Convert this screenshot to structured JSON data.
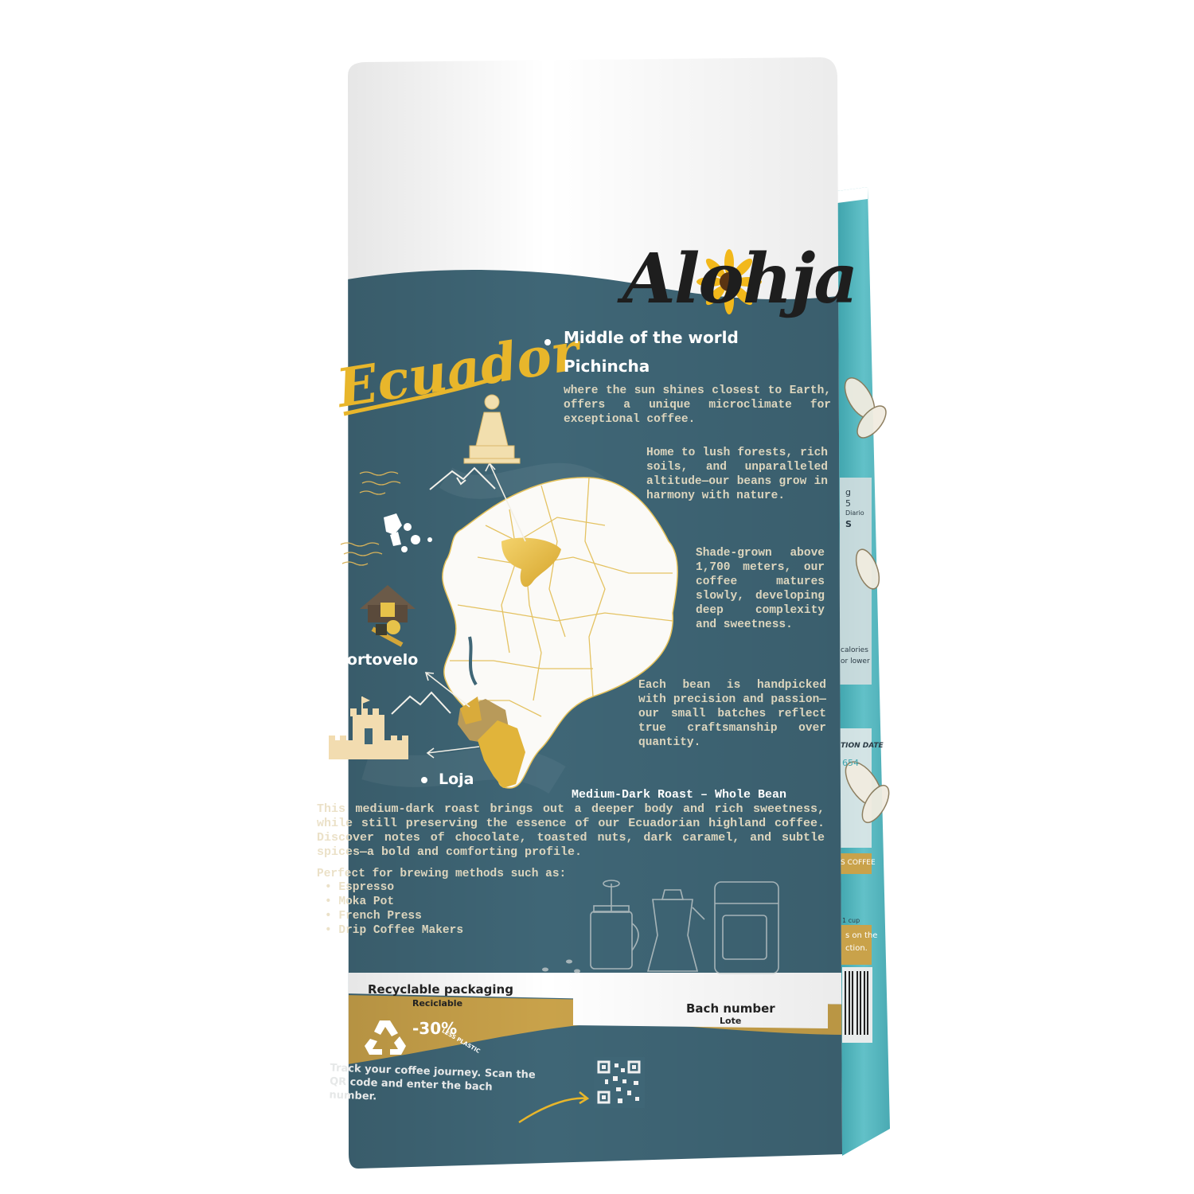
{
  "brand": {
    "logo_text": "Alohja"
  },
  "origin": {
    "title": "Ecuador"
  },
  "regions": {
    "pichincha": {
      "line1": "Middle of the world",
      "line2": "Pichincha",
      "desc": "where the sun shines closest to Earth, offers a unique microclimate for exceptional coffee."
    },
    "portovelo": {
      "label": "Portovelo"
    },
    "loja": {
      "label": "Loja"
    }
  },
  "paragraphs": {
    "forests": "Home to lush forests, rich soils, and unparalleled altitude—our beans grow in harmony with nature.",
    "shade": "Shade-grown above 1,700 meters, our coffee matures slowly, developing deep complexity and sweetness.",
    "handpicked": "Each bean is handpicked with precision and passion—our small batches reflect true craftsmanship over quantity."
  },
  "roast": {
    "heading": "Medium-Dark Roast – Whole Bean",
    "description": "This medium-dark roast brings out a deeper body and rich sweetness, while still preserving the essence of our Ecuadorian highland coffee. Discover notes of chocolate, toasted nuts, dark caramel, and subtle spices—a bold and comforting profile."
  },
  "brewing": {
    "intro": "Perfect for brewing methods such as:",
    "methods": [
      "Espresso",
      "Moka Pot",
      "French Press",
      "Drip Coffee Makers"
    ]
  },
  "packaging": {
    "recyclable_label": "Recyclable packaging",
    "recyclable_sub": "Reciclable",
    "reduction": "-30%",
    "reduction_note": "LESS PLASTIC",
    "batch_label": "Bach number",
    "batch_sub": "Lote"
  },
  "tracking": {
    "text": "Track your coffee journey. Scan the QR code and enter the bach number."
  },
  "side_panel": {
    "fragments": [
      "g",
      "5",
      "Diario",
      "S",
      "calories",
      "or lower",
      "TION DATE",
      "654",
      "S COFFEE",
      "1 cup",
      "s on the",
      "ction."
    ]
  },
  "colors": {
    "slate": "#3f6676",
    "gold": "#c9a24a",
    "teal": "#5bb7bf",
    "cream": "#efe3c8",
    "map_gold": "#e1b43a"
  }
}
